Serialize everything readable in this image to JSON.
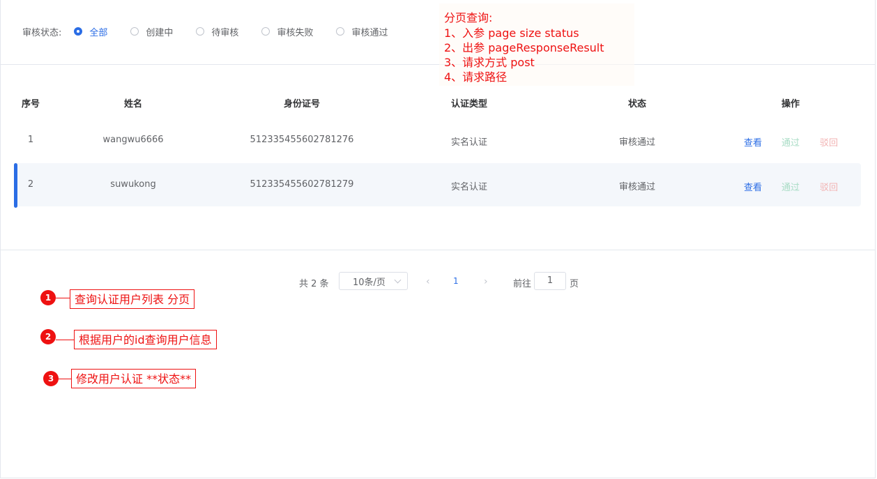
{
  "filter": {
    "label": "审核状态:",
    "options": [
      "全部",
      "创建中",
      "待审核",
      "审核失败",
      "审核通过"
    ],
    "selected": "全部"
  },
  "table": {
    "headers": [
      "序号",
      "姓名",
      "身份证号",
      "认证类型",
      "状态",
      "操作"
    ],
    "rows": [
      {
        "index": "1",
        "name": "wangwu6666",
        "id_number": "512335455602781276",
        "auth_type": "实名认证",
        "status": "审核通过"
      },
      {
        "index": "2",
        "name": "suwukong",
        "id_number": "512335455602781279",
        "auth_type": "实名认证",
        "status": "审核通过"
      }
    ],
    "actions": {
      "view": "查看",
      "pass": "通过",
      "reject": "驳回"
    }
  },
  "pagination": {
    "total_text": "共 2 条",
    "page_size": "10条/页",
    "prev": "‹",
    "next": "›",
    "current_page": "1",
    "goto_label": "前往",
    "goto_value": "1",
    "goto_suffix": "页"
  },
  "note": {
    "lines": [
      "分页查询:",
      "1、入参 page size  status",
      "2、出参 pageResponseResult",
      "3、请求方式 post",
      "4、请求路径"
    ]
  },
  "annotations": [
    {
      "number": "1",
      "text": "查询认证用户列表 分页"
    },
    {
      "number": "2",
      "text": "根据用户的id查询用户信息"
    },
    {
      "number": "3",
      "text": "修改用户认证 **状态**"
    }
  ],
  "colors": {
    "accent": "#2b6de5",
    "annotation": "#ee1111",
    "pass": "#a8dcc5",
    "reject": "#f2b3b3"
  }
}
